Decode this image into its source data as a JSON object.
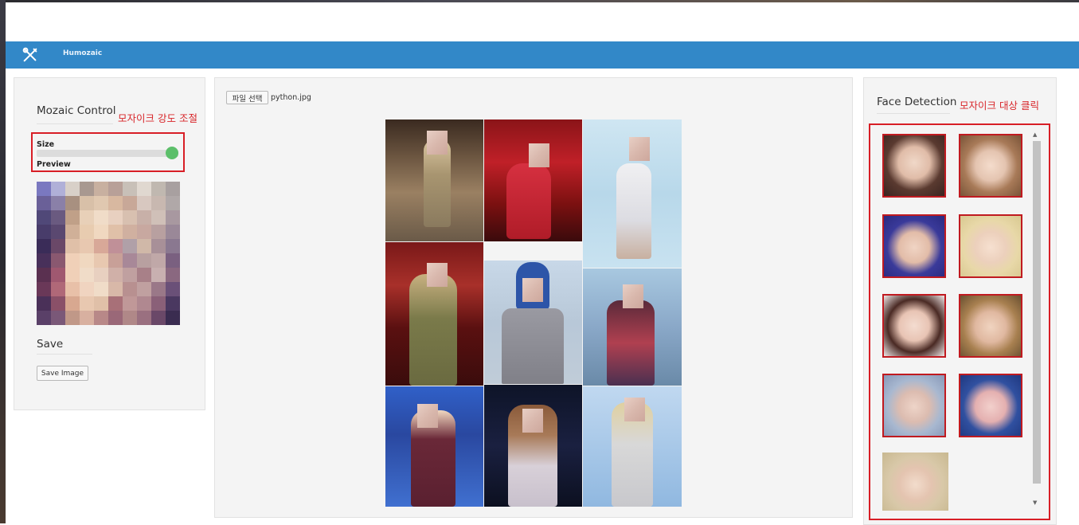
{
  "app": {
    "title": "Humozaic"
  },
  "left": {
    "heading": "Mozaic Control",
    "annotation": "모자이크 강도 조절",
    "size_label": "Size",
    "size_value": 1.0,
    "preview_label": "Preview",
    "save_heading": "Save",
    "save_button": "Save Image"
  },
  "center": {
    "file_button": "파일 선택",
    "file_name": "python.jpg"
  },
  "right": {
    "heading": "Face Detection",
    "annotation": "모자이크 대상 클릭",
    "face_count": 9
  },
  "colors": {
    "navbar": "#3288c8",
    "annotation": "#d81e26",
    "slider_thumb": "#5cbf6a"
  }
}
